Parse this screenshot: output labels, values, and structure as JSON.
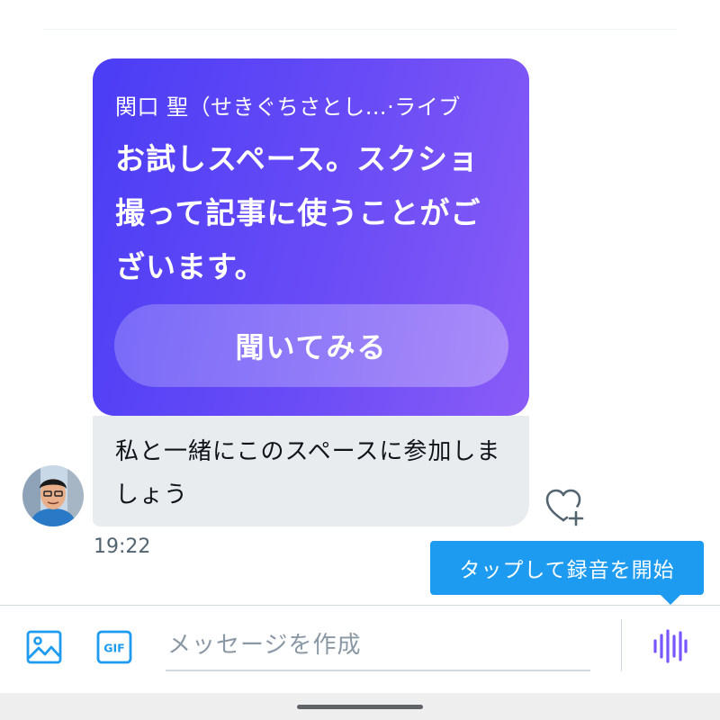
{
  "space_card": {
    "host": "関口 聖（せきぐちさとし…·ライブ",
    "title": "お試しスペース。スクショ撮って記事に使うことがございます。",
    "listen_button": "聞いてみる"
  },
  "message": {
    "text": "私と一緒にこのスペースに参加しましょう",
    "timestamp": "19:22"
  },
  "tooltip": {
    "text": "タップして録音を開始"
  },
  "composer": {
    "placeholder": "メッセージを作成",
    "gif_label": "GIF",
    "icons": [
      "image-icon",
      "gif-icon",
      "voice-message-icon"
    ]
  },
  "colors": {
    "accent": "#1d9bf0",
    "card_gradient_start": "#4a3df5",
    "card_gradient_end": "#8a5cf7",
    "bubble_bg": "#e9ecef",
    "voice_icon": "#7856ff"
  }
}
